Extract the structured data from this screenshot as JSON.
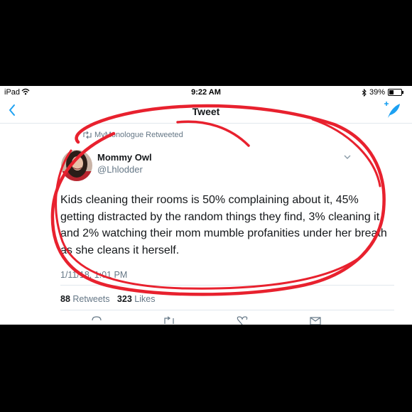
{
  "status_bar": {
    "carrier": "iPad",
    "time": "9:22 AM",
    "battery": "39%",
    "battery_level": 0.39
  },
  "nav": {
    "title": "Tweet"
  },
  "retweet_label": "MyMonologue Retweeted",
  "tweet": {
    "author_name": "Mommy Owl",
    "author_handle": "@Lhlodder",
    "text": "Kids cleaning their rooms is 50% complaining about it, 45% getting distracted by the random things they find, 3% cleaning it, and 2% watching their mom mumble profanities under her breath as she cleans it herself.",
    "date": "1/11/18, 1:01 PM",
    "retweets": {
      "count": "88",
      "label": "Retweets"
    },
    "likes": {
      "count": "323",
      "label": "Likes"
    }
  },
  "colors": {
    "link_blue": "#1da1f2",
    "annotation_red": "#e8212e"
  }
}
